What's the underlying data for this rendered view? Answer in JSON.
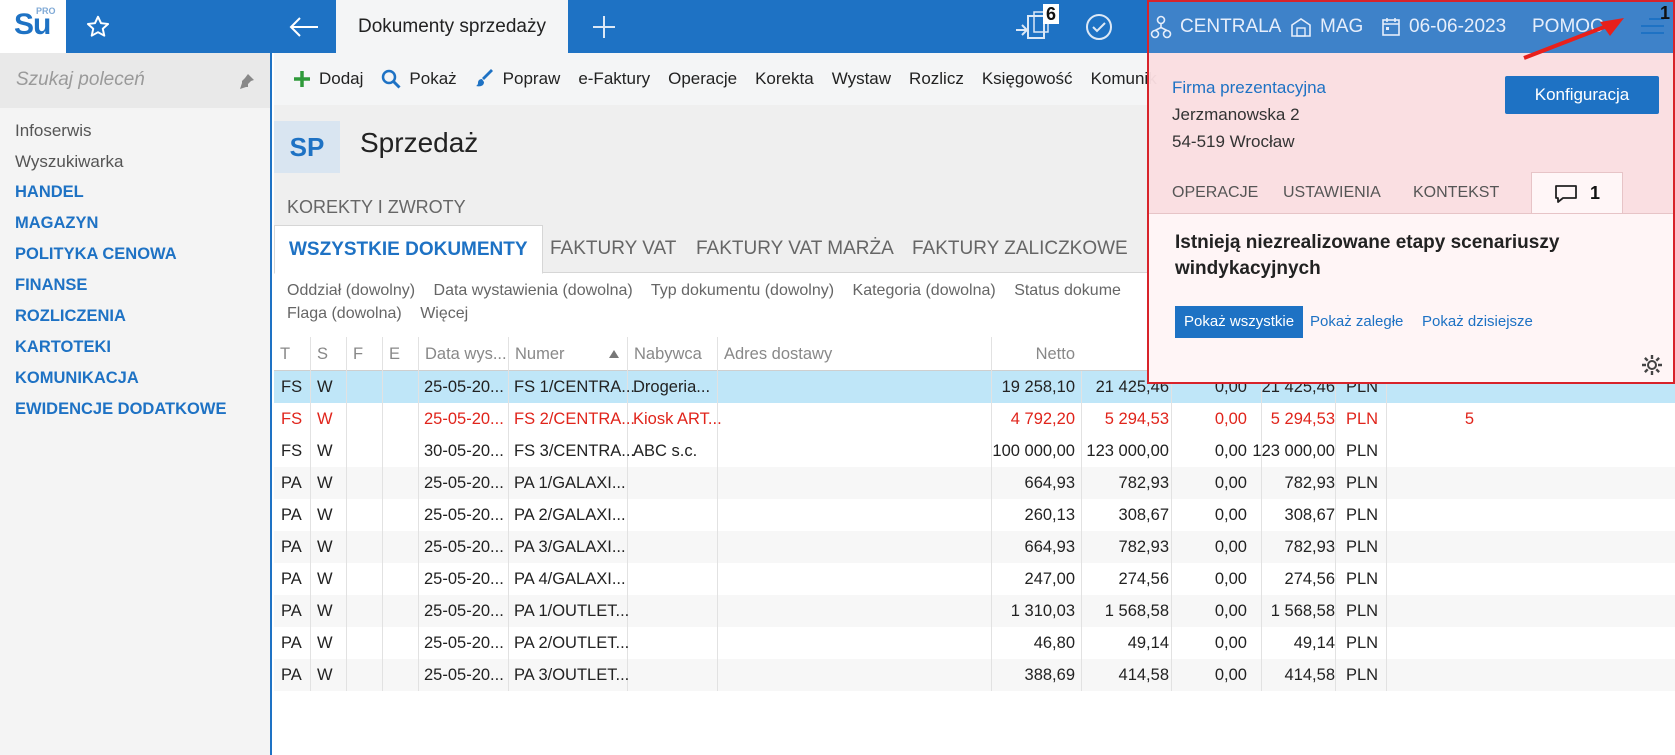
{
  "app": {
    "logo": "Su",
    "logo_edition": "PRO",
    "active_tab": "Dokumenty sprzedaży",
    "docs_count": "6",
    "branch": "CENTRALA",
    "warehouse": "MAG",
    "date": "06-06-2023",
    "help": "POMOC",
    "menu_count": "1"
  },
  "sidebar": {
    "search_placeholder": "Szukaj poleceń",
    "items": [
      {
        "label": "Infoserwis",
        "kind": "plain"
      },
      {
        "label": "Wyszukiwarka",
        "kind": "plain"
      },
      {
        "label": "HANDEL",
        "kind": "cat"
      },
      {
        "label": "MAGAZYN",
        "kind": "cat"
      },
      {
        "label": "POLITYKA CENOWA",
        "kind": "cat"
      },
      {
        "label": "FINANSE",
        "kind": "cat"
      },
      {
        "label": "ROZLICZENIA",
        "kind": "cat"
      },
      {
        "label": "KARTOTEKI",
        "kind": "cat"
      },
      {
        "label": "KOMUNIKACJA",
        "kind": "cat"
      },
      {
        "label": "EWIDENCJE DODATKOWE",
        "kind": "cat"
      }
    ]
  },
  "toolbar": {
    "add": "Dodaj",
    "show": "Pokaż",
    "edit": "Popraw",
    "efaktury": "e-Faktury",
    "operacje": "Operacje",
    "korekta": "Korekta",
    "wystaw": "Wystaw",
    "rozlicz": "Rozlicz",
    "ksiegowosc": "Księgowość",
    "komunikacja": "Komunik"
  },
  "header": {
    "badge": "SP",
    "title": "Sprzedaż",
    "subtitle": "KOREKTY I ZWROTY"
  },
  "tabs": [
    "WSZYSTKIE DOKUMENTY",
    "FAKTURY VAT",
    "FAKTURY VAT MARŻA",
    "FAKTURY ZALICZKOWE"
  ],
  "filters": {
    "line1": [
      "Oddział (dowolny)",
      "Data wystawienia (dowolna)",
      "Typ dokumentu (dowolny)",
      "Kategoria (dowolna)",
      "Status dokume"
    ],
    "line2": [
      "Flaga (dowolna)",
      "Więcej"
    ]
  },
  "grid": {
    "columns": [
      "T",
      "S",
      "F",
      "E",
      "Data wys...",
      "Numer",
      "Nabywca",
      "Adres dostawy",
      "Netto"
    ],
    "rows": [
      {
        "t": "FS",
        "s": "W",
        "date": "25-05-20...",
        "num": "FS 1/CENTRA...",
        "buyer": "Drogeria...",
        "netto": "19 258,10",
        "brutto": "21 425,46",
        "zero": "0,00",
        "total": "21 425,46",
        "cur": "PLN",
        "extra": "",
        "style": "sel"
      },
      {
        "t": "FS",
        "s": "W",
        "date": "25-05-20...",
        "num": "FS 2/CENTRA...",
        "buyer": "Kiosk ART...",
        "netto": "4 792,20",
        "brutto": "5 294,53",
        "zero": "0,00",
        "total": "5 294,53",
        "cur": "PLN",
        "extra": "5",
        "style": "red"
      },
      {
        "t": "FS",
        "s": "W",
        "date": "30-05-20...",
        "num": "FS 3/CENTRA...",
        "buyer": "ABC s.c.",
        "netto": "100 000,00",
        "brutto": "123 000,00",
        "zero": "0,00",
        "total": "123 000,00",
        "cur": "PLN",
        "extra": "",
        "style": ""
      },
      {
        "t": "PA",
        "s": "W",
        "date": "25-05-20...",
        "num": "PA 1/GALAXI...",
        "buyer": "",
        "netto": "664,93",
        "brutto": "782,93",
        "zero": "0,00",
        "total": "782,93",
        "cur": "PLN",
        "extra": "",
        "style": "alt"
      },
      {
        "t": "PA",
        "s": "W",
        "date": "25-05-20...",
        "num": "PA 2/GALAXI...",
        "buyer": "",
        "netto": "260,13",
        "brutto": "308,67",
        "zero": "0,00",
        "total": "308,67",
        "cur": "PLN",
        "extra": "",
        "style": ""
      },
      {
        "t": "PA",
        "s": "W",
        "date": "25-05-20...",
        "num": "PA 3/GALAXI...",
        "buyer": "",
        "netto": "664,93",
        "brutto": "782,93",
        "zero": "0,00",
        "total": "782,93",
        "cur": "PLN",
        "extra": "",
        "style": "alt"
      },
      {
        "t": "PA",
        "s": "W",
        "date": "25-05-20...",
        "num": "PA 4/GALAXI...",
        "buyer": "",
        "netto": "247,00",
        "brutto": "274,56",
        "zero": "0,00",
        "total": "274,56",
        "cur": "PLN",
        "extra": "",
        "style": ""
      },
      {
        "t": "PA",
        "s": "W",
        "date": "25-05-20...",
        "num": "PA 1/OUTLET...",
        "buyer": "",
        "netto": "1 310,03",
        "brutto": "1 568,58",
        "zero": "0,00",
        "total": "1 568,58",
        "cur": "PLN",
        "extra": "",
        "style": "alt"
      },
      {
        "t": "PA",
        "s": "W",
        "date": "25-05-20...",
        "num": "PA 2/OUTLET...",
        "buyer": "",
        "netto": "46,80",
        "brutto": "49,14",
        "zero": "0,00",
        "total": "49,14",
        "cur": "PLN",
        "extra": "",
        "style": ""
      },
      {
        "t": "PA",
        "s": "W",
        "date": "25-05-20...",
        "num": "PA 3/OUTLET...",
        "buyer": "",
        "netto": "388,69",
        "brutto": "414,58",
        "zero": "0,00",
        "total": "414,58",
        "cur": "PLN",
        "extra": "",
        "style": "alt"
      }
    ]
  },
  "popup": {
    "company_name": "Firma prezentacyjna",
    "address1": "Jerzmanowska 2",
    "address2": "54-519 Wrocław",
    "config_button": "Konfiguracja",
    "tabs": [
      "OPERACJE",
      "USTAWIENIA",
      "KONTEKST"
    ],
    "messages_count": "1",
    "message": "Istnieją niezrealizowane etapy scenariuszy windykacyjnych",
    "show_all": "Pokaż wszystkie",
    "show_overdue": "Pokaż zaległe",
    "show_today": "Pokaż dzisiejsze"
  },
  "colors": {
    "brand": "#1e72c4",
    "selected_row": "#bfe6f8",
    "warning_row": "#e0241b",
    "popup_border": "#d8232a"
  },
  "icons": [
    "star-icon",
    "arrow-left-icon",
    "plus-icon",
    "documents-icon",
    "check-circle-icon",
    "branch-icon",
    "warehouse-icon",
    "calendar-icon",
    "hamburger-menu-icon",
    "pin-icon",
    "add-icon",
    "search-icon",
    "brush-icon",
    "sort-asc-icon",
    "chat-icon",
    "gear-icon"
  ]
}
